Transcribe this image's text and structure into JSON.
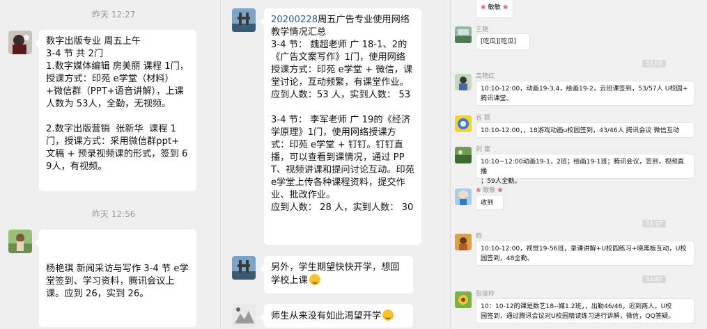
{
  "panel_left": {
    "timestamp1": "昨天 12:27",
    "msg1": "数字出版专业 周五上午\n3-4 节 共 2门\n1.数字媒体编辑 房美丽 课程 1门，授课方式：印苑 e学堂（材料）+微信群（PPT+语音讲解），上课人数为 53人，全勤，无视频。\n\n2.数字出版营销  张新华  课程 1门，授课方式：采用微信群ppt+ 文稿 + 预录视频课的形式，签到 69人，有视频。",
    "timestamp2": "昨天 12:56",
    "msg2": "杨艳琪 新闻采访与写作 3-4 节 e学堂签到、学习资料，腾讯会议上课。应到 26，实到 26。"
  },
  "panel_middle": {
    "msg1_title": "20200228",
    "msg1_body": "周五广告专业使用网络教学情况汇总\n3-4 节： 魏超老师 广 18-1、2的《广告文案写作》1门，使用网络授课方式：印苑 e学堂 + 微信，课堂讨论，互动频繁，有课堂作业。应到人数：53 人，实到人数： 53\n\n3-4 节： 李军老师 广 19的《经济学原理》1门，使用网络授课方式：印苑 e学堂 + 钉钉。钉钉直播，可以查看到课情况，通过 PPT、视频讲课和提问讨论互动。印苑 e学堂上传各种课程资料，提交作业、批改作业。\n应到人数： 28 人，实到人数： 30",
    "msg2": "另外，学生期望快快开学，想回学校上课",
    "msg3": "师生从来没有如此渴望开学"
  },
  "panel_right": {
    "top_name": "敏敏",
    "items": [
      {
        "name": "王艳",
        "text": "[吃瓜][吃瓜]"
      },
      {
        "time": "11:03"
      },
      {
        "name": "高艳红",
        "text": "10:10-12:00，动画19-3,4，绘画19-2，云班课签到，53/57人 U校园+\n腾讯课堂。"
      },
      {
        "name": "谷 颖",
        "text": "10:10-12:00，，18游戏动画u校园签到，43/46人 腾讯会议 微信互动"
      },
      {
        "name": "刘 蕾",
        "text": "10:10~12:00动画19-1，2班；绘画19-1班；腾讯会议，签到，视频直播\n；59人全勤。"
      },
      {
        "name": "敏敏",
        "text": "收到"
      },
      {
        "time": "11:17"
      },
      {
        "name": "晗",
        "text": "10:10-12:00，视觉19-56班，录课讲解+U校园练习+晓黑板互动，U校\n园签到，48全勤。"
      },
      {
        "time": "11:47"
      },
      {
        "name": "张俊玲",
        "text": "10：10-12的课是数艺18--媒1.2班，，出勤46/46，迟到两人。U校\n园签到，通过腾讯会议对U校园精读练习进行讲解，微信，QQ答疑。"
      }
    ]
  },
  "colors": {
    "bg": "#efefef",
    "bubble": "#ffffff",
    "link": "#2f5c99",
    "time_badge": "#dadada"
  }
}
